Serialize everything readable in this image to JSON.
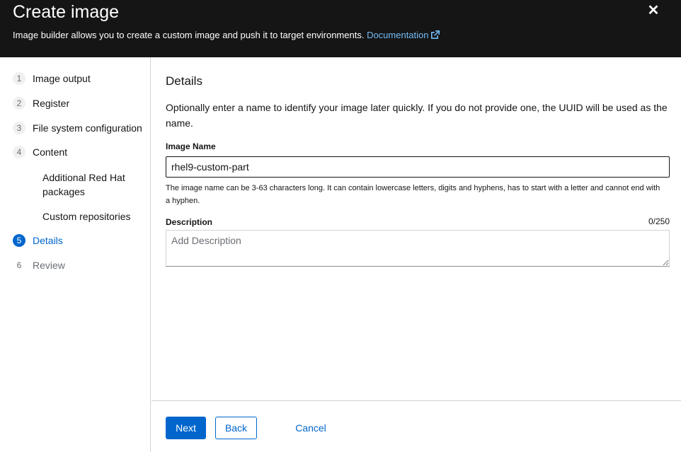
{
  "header": {
    "title": "Create image",
    "subtitle": "Image builder allows you to create a custom image and push it to target environments.",
    "doc_link": "Documentation",
    "close_icon": "close-icon"
  },
  "nav": {
    "items": [
      {
        "number": "1",
        "label": "Image output",
        "state": "default"
      },
      {
        "number": "2",
        "label": "Register",
        "state": "default"
      },
      {
        "number": "3",
        "label": "File system configuration",
        "state": "default"
      },
      {
        "number": "4",
        "label": "Content",
        "state": "default"
      },
      {
        "number": "5",
        "label": "Details",
        "state": "current"
      },
      {
        "number": "6",
        "label": "Review",
        "state": "disabled"
      }
    ],
    "sub_items": [
      {
        "label": "Additional Red Hat packages"
      },
      {
        "label": "Custom repositories"
      }
    ]
  },
  "details": {
    "title": "Details",
    "intro": "Optionally enter a name to identify your image later quickly. If you do not provide one, the UUID will be used as the name.",
    "name_label": "Image Name",
    "name_value": "rhel9-custom-part",
    "name_helper": "The image name can be 3-63 characters long. It can contain lowercase letters, digits and hyphens, has to start with a letter and cannot end with a hyphen.",
    "description_label": "Description",
    "description_counter": "0/250",
    "description_placeholder": "Add Description"
  },
  "footer": {
    "next": "Next",
    "back": "Back",
    "cancel": "Cancel"
  },
  "colors": {
    "header_bg": "#151515",
    "primary": "#0066cc",
    "link_light": "#73bcf7"
  }
}
